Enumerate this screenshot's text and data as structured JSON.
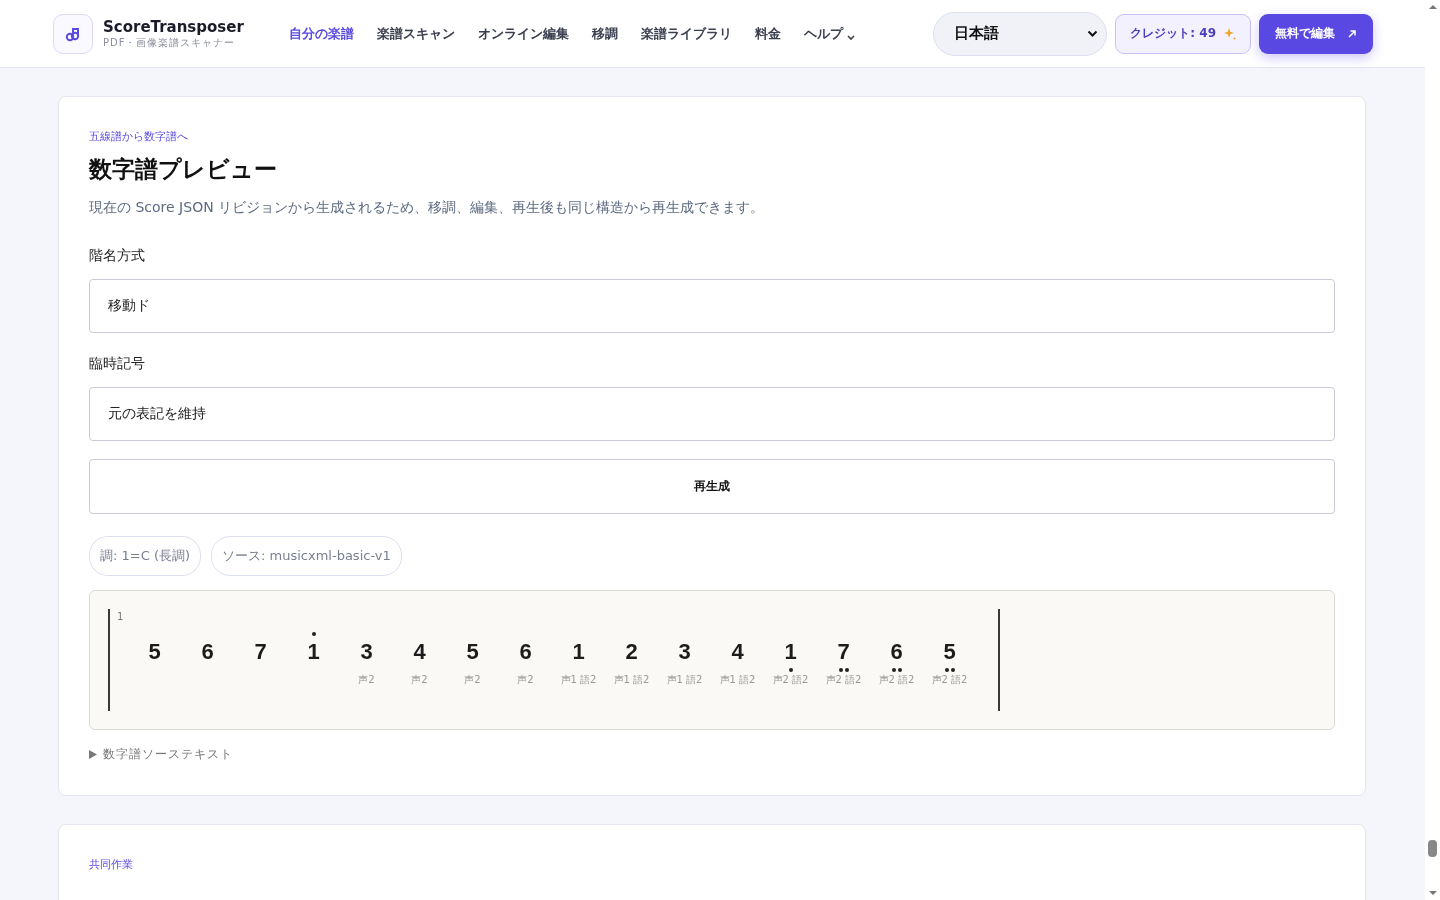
{
  "header": {
    "brand": "ScoreTransposer",
    "tagline": "PDF・画像楽譜スキャナー",
    "nav": [
      {
        "label": "自分の楽譜",
        "selected": true
      },
      {
        "label": "楽譜スキャン",
        "selected": false
      },
      {
        "label": "オンライン編集",
        "selected": false
      },
      {
        "label": "移調",
        "selected": false
      },
      {
        "label": "楽譜ライブラリ",
        "selected": false
      },
      {
        "label": "料金",
        "selected": false
      },
      {
        "label": "ヘルプ",
        "selected": false,
        "kind": "dropdown"
      }
    ],
    "language": "日本語",
    "credits": "クレジット: 49",
    "cta": "無料で編集"
  },
  "preview": {
    "eyebrow": "五線譜から数字譜へ",
    "title": "数字譜プレビュー",
    "description": "現在の Score JSON リビジョンから生成されるため、移調、編集、再生後も同じ構造から再生成できます。",
    "fields": [
      {
        "label": "階名方式",
        "value": "移動ド"
      },
      {
        "label": "臨時記号",
        "value": "元の表記を維持"
      }
    ],
    "button": "再生成",
    "chips": [
      "調: 1=C (長調)",
      "ソース: musicxml-basic-v1"
    ],
    "measure_number": "1",
    "notes": [
      {
        "kind": "plain",
        "digit": "5"
      },
      {
        "kind": "plain",
        "digit": "6"
      },
      {
        "kind": "plain",
        "digit": "7"
      },
      {
        "kind": "high",
        "digit": "1"
      },
      {
        "kind": "plain",
        "digit": "3",
        "lyric": "声2"
      },
      {
        "kind": "plain",
        "digit": "4",
        "lyric": "声2"
      },
      {
        "kind": "plain",
        "digit": "5",
        "lyric": "声2"
      },
      {
        "kind": "plain",
        "digit": "6",
        "lyric": "声2"
      },
      {
        "kind": "plain",
        "digit": "1",
        "lyric": "声1 語2"
      },
      {
        "kind": "plain",
        "digit": "2",
        "lyric": "声1 語2"
      },
      {
        "kind": "plain",
        "digit": "3",
        "lyric": "声1 語2"
      },
      {
        "kind": "plain",
        "digit": "4",
        "lyric": "声1 語2"
      },
      {
        "kind": "low",
        "digit": "1",
        "lyric": "声2 語2"
      },
      {
        "kind": "double_low",
        "digit": "7",
        "lyric": "声2 語2"
      },
      {
        "kind": "double_low",
        "digit": "6",
        "lyric": "声2 語2"
      },
      {
        "kind": "double_low",
        "digit": "5",
        "lyric": "声2 語2"
      }
    ],
    "source_toggle": {
      "label": "数字譜ソーステキスト",
      "expanded": false
    }
  },
  "next_section": {
    "eyebrow": "共同作業"
  }
}
